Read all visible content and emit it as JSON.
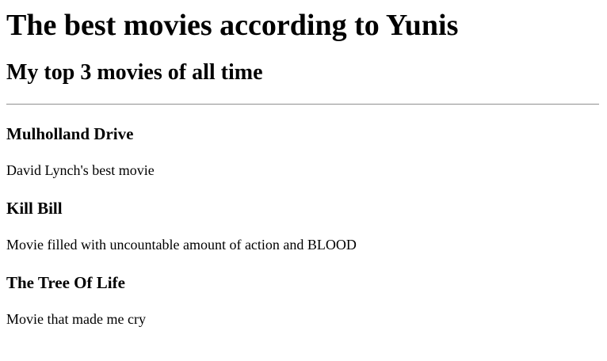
{
  "page": {
    "title": "The best movies according to Yunis",
    "subtitle": "My top 3 movies of all time"
  },
  "movies": [
    {
      "title": "Mulholland Drive",
      "description": "David Lynch's best movie"
    },
    {
      "title": "Kill Bill",
      "description": "Movie filled with uncountable amount of action and BLOOD"
    },
    {
      "title": "The Tree Of Life",
      "description": "Movie that made me cry"
    }
  ]
}
